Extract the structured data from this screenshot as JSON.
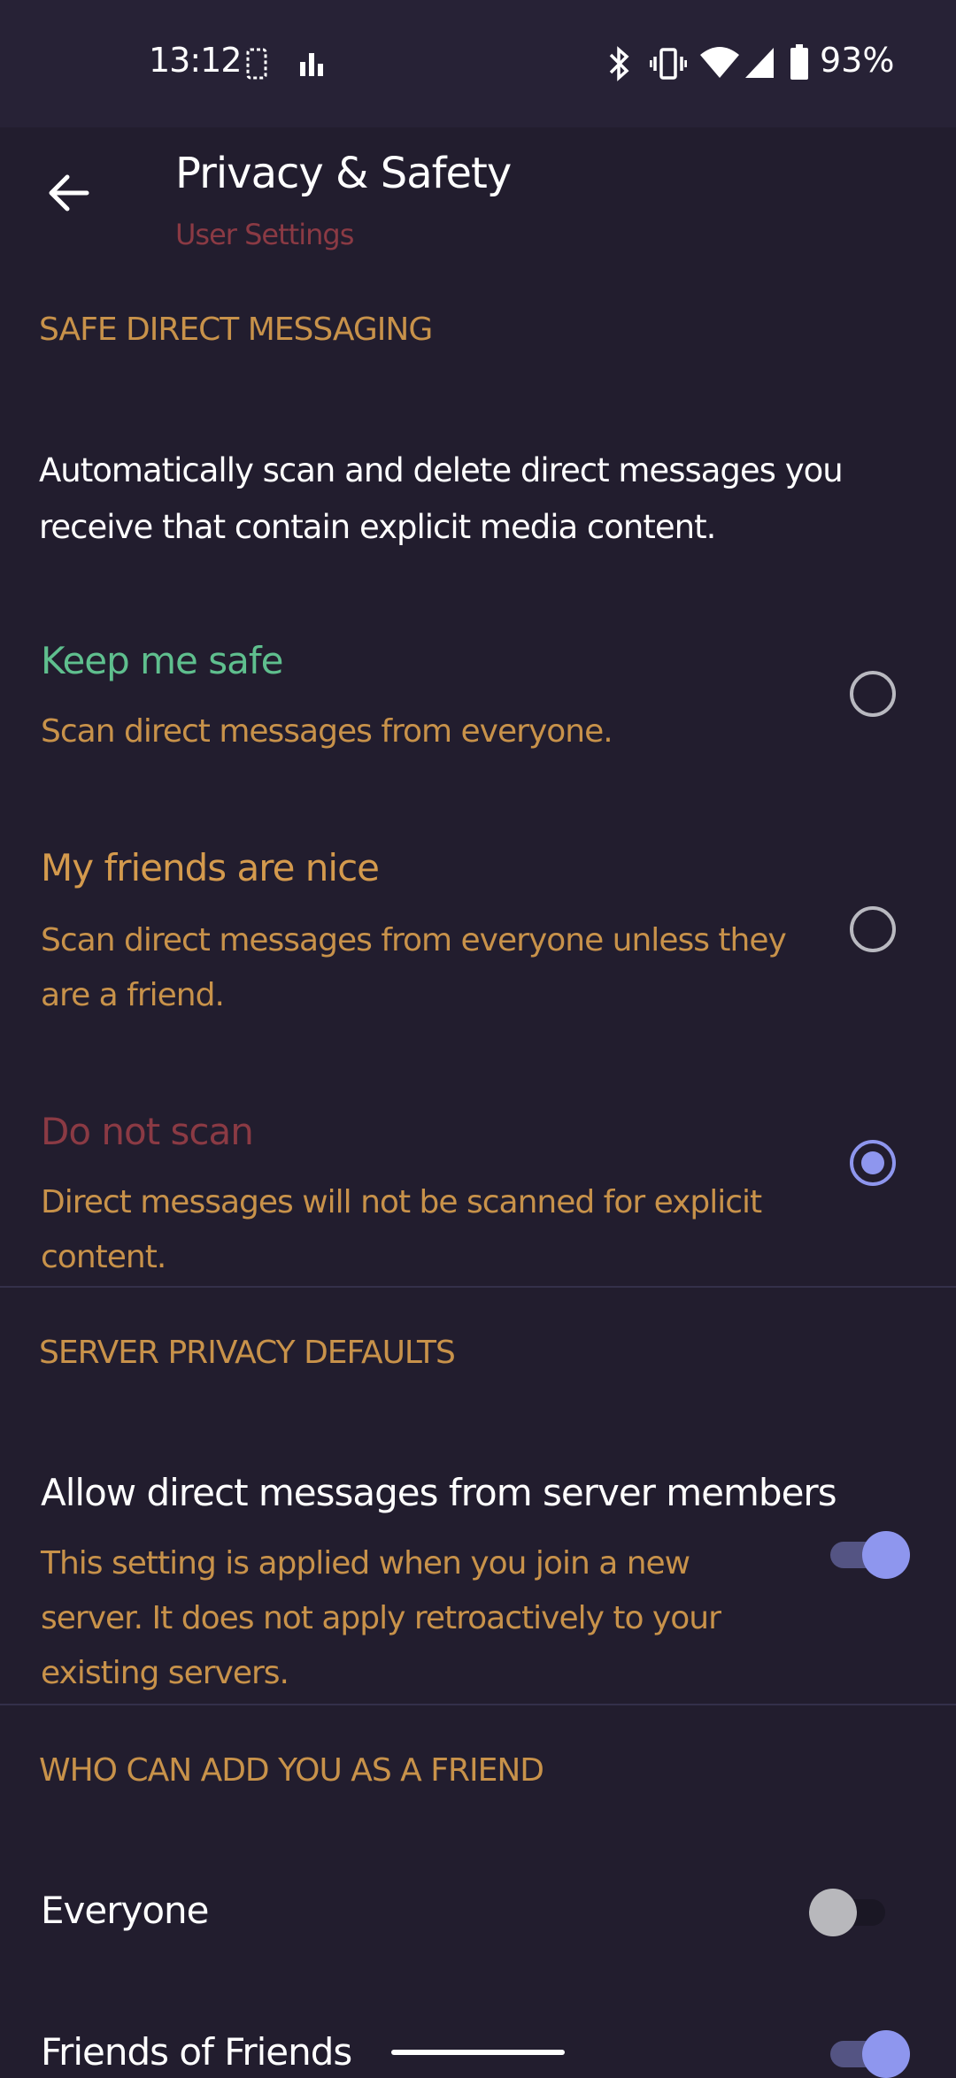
{
  "status_bar": {
    "time": "13:12",
    "battery": "93%",
    "icons": [
      "screenshot-icon",
      "signal-bars-icon",
      "bluetooth-icon",
      "vibrate-icon",
      "wifi-icon",
      "cell-signal-icon",
      "battery-icon"
    ]
  },
  "header": {
    "title": "Privacy & Safety",
    "subtitle": "User Settings"
  },
  "safe_dm": {
    "section_title": "SAFE DIRECT MESSAGING",
    "description": "Automatically scan and delete direct messages you receive that contain explicit media content.",
    "options": [
      {
        "title": "Keep me safe",
        "subtitle": "Scan direct messages from everyone.",
        "selected": false,
        "title_color": "#5fbf8e"
      },
      {
        "title": "My friends are nice",
        "subtitle": "Scan direct messages from everyone unless they are a friend.",
        "selected": false,
        "title_color": "#d49a4d"
      },
      {
        "title": "Do not scan",
        "subtitle": "Direct messages will not be scanned for explicit content.",
        "selected": true,
        "title_color": "#8b3a44"
      }
    ]
  },
  "server_privacy": {
    "section_title": "SERVER PRIVACY DEFAULTS",
    "setting_title": "Allow direct messages from server members",
    "setting_subtitle": "This setting is applied when you join a new server. It does not apply retroactively to your existing servers.",
    "enabled": true
  },
  "friend_requests": {
    "section_title": "WHO CAN ADD YOU AS A FRIEND",
    "items": [
      {
        "label": "Everyone",
        "enabled": false
      },
      {
        "label": "Friends of Friends",
        "enabled": true
      }
    ]
  },
  "colors": {
    "background": "#221d2e",
    "accent": "#8e96ee",
    "section_header": "#c8924a",
    "subtitle_red": "#8b3a44"
  }
}
